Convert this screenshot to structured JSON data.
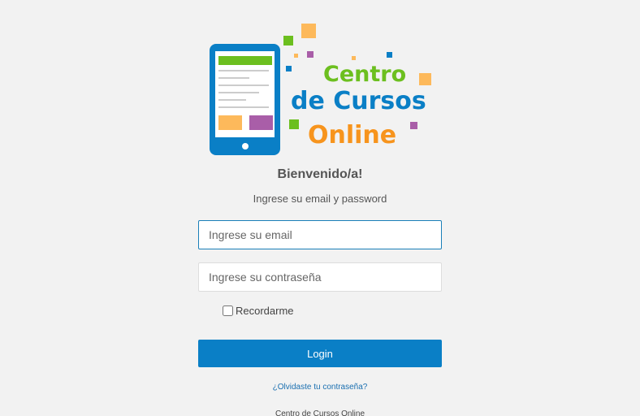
{
  "logo": {
    "line1": "Centro",
    "line2": "de Cursos",
    "line3": "Online",
    "colors": {
      "green": "#6cbf1f",
      "blue": "#0a7fc6",
      "orange": "#f7941d",
      "yellow": "#fdb95b",
      "purple": "#a95ea8"
    }
  },
  "welcome": "Bienvenido/a!",
  "subtitle": "Ingrese su email y password",
  "form": {
    "email_placeholder": "Ingrese su email",
    "password_placeholder": "Ingrese su contraseña",
    "remember_label": "Recordarme",
    "remember_checked": false,
    "login_label": "Login",
    "forgot_label": "¿Olvidaste tu contraseña?"
  },
  "footer": "Centro de Cursos Online",
  "colors": {
    "background": "#f2f2f2",
    "primary": "#0a7fc6",
    "link": "#1a6fb0"
  }
}
